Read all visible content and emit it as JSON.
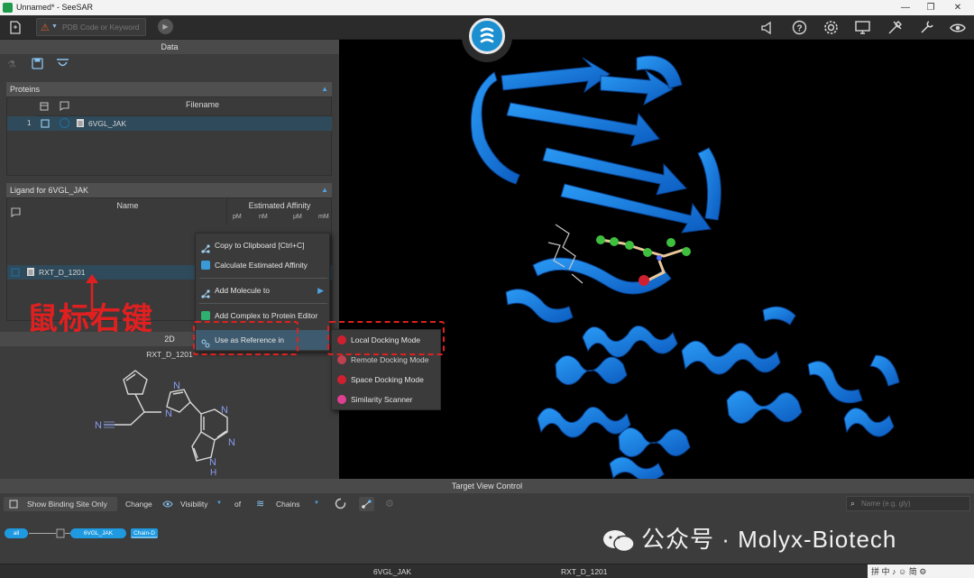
{
  "window": {
    "title": "Unnamed* - SeeSAR"
  },
  "toolbar": {
    "search_placeholder": "PDB Code or Keyword"
  },
  "left_panel": {
    "header": "Data",
    "proteins": {
      "section_title": "Proteins",
      "column_filename": "Filename",
      "rows": [
        {
          "index": "1",
          "filename": "6VGL_JAK"
        }
      ]
    },
    "ligands": {
      "section_title": "Ligand for 6VGL_JAK",
      "column_name": "Name",
      "column_affinity": "Estimated Affinity",
      "affinity_units": [
        "pM",
        "nM",
        "μM",
        "mM"
      ],
      "rows": [
        {
          "name": "RXT_D_1201"
        }
      ]
    },
    "annotation_label": "鼠标右键",
    "view2d": {
      "tab": "2D",
      "molecule_name": "RXT_D_1201"
    }
  },
  "molecule_atoms": {
    "n1": "N",
    "n2": "N",
    "n3": "N",
    "n4": "N",
    "n5": "N",
    "nh": "N",
    "h": "H"
  },
  "context_menu": {
    "items": [
      {
        "label": "Copy to Clipboard [Ctrl+C]",
        "icon": "share-nodes-icon"
      },
      {
        "label": "Calculate Estimated Affinity",
        "icon": "calculator-icon"
      },
      {
        "label": "Add Molecule to",
        "icon": "share-nodes-icon"
      },
      {
        "label": "Add Complex to Protein Editor",
        "icon": "protein-editor-icon"
      },
      {
        "label": "Use as Reference in",
        "icon": "reference-icon"
      }
    ]
  },
  "submenu": {
    "items": [
      {
        "label": "Local Docking Mode",
        "icon": "docking-icon"
      },
      {
        "label": "Remote Docking Mode",
        "icon": "remote-docking-icon"
      },
      {
        "label": "Space Docking Mode",
        "icon": "space-docking-icon"
      },
      {
        "label": "Similarity Scanner",
        "icon": "similarity-icon"
      }
    ]
  },
  "target_view_control": {
    "header": "Target View Control",
    "show_binding_site": "Show Binding Site Only",
    "change_label": "Change",
    "visibility_label": "Visibility",
    "of_label": "of",
    "chains_label": "Chains",
    "name_placeholder": "Name (e.g. gly)",
    "chips": {
      "all": "all",
      "protein": "6VGL_JAK",
      "chain": "Chain-D"
    }
  },
  "status_bar": {
    "protein": "6VGL_JAK",
    "ligand": "RXT_D_1201"
  },
  "watermark": "公众号 · Molyx-Biotech",
  "taskbar_snippet": "拼 中 ♪ ☺ 简 ⚙",
  "colors": {
    "ribbon": "#1a7fe0",
    "accent": "#1f9ae0",
    "annotation_red": "#e02020"
  }
}
